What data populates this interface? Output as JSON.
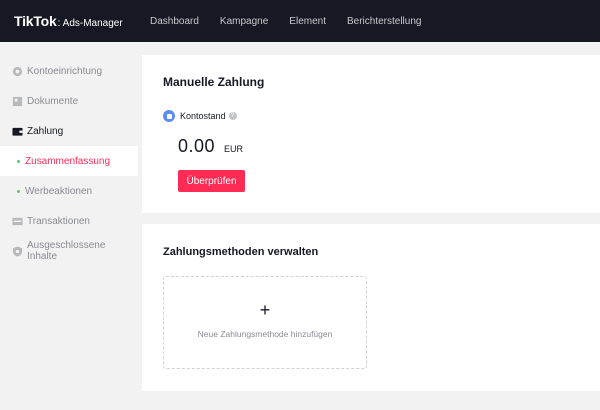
{
  "header": {
    "logo_main": "TikTok",
    "logo_sub": ": Ads-Manager",
    "nav": [
      "Dashboard",
      "Kampagne",
      "Element",
      "Berichterstellung"
    ]
  },
  "sidebar": {
    "items": [
      {
        "label": "Kontoeinrichtung",
        "icon": "account-setup-icon"
      },
      {
        "label": "Dokumente",
        "icon": "documents-icon"
      },
      {
        "label": "Zahlung",
        "icon": "wallet-icon"
      },
      {
        "label": "Zusammenfassung"
      },
      {
        "label": "Werbeaktionen"
      },
      {
        "label": "Transaktionen",
        "icon": "transactions-icon"
      },
      {
        "label": "Ausgeschlossene Inhalte",
        "icon": "shield-icon"
      }
    ]
  },
  "manual_payment": {
    "title": "Manuelle Zahlung",
    "balance_label": "Kontostand",
    "help_glyph": "?",
    "balance_value": "0.00",
    "currency": "EUR",
    "review_button": "Überprüfen"
  },
  "payment_methods": {
    "title": "Zahlungsmethoden verwalten",
    "add_glyph": "+",
    "add_label": "Neue Zahlungsmethode hinzufügen"
  },
  "colors": {
    "accent": "#fe2c55",
    "topbar": "#161823",
    "badge": "#5b8def",
    "dot": "#5ec96b"
  }
}
